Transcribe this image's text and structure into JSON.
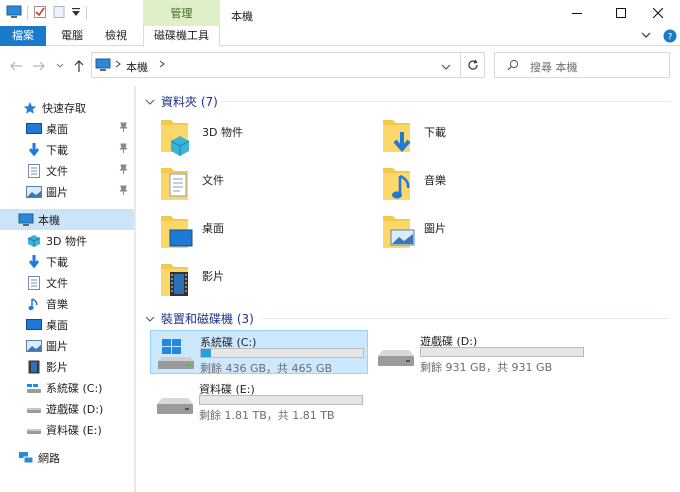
{
  "window": {
    "title": "本機",
    "context_tab": "管理"
  },
  "ribbon": {
    "tabs": [
      "檔案",
      "電腦",
      "檢視",
      "磁碟機工具"
    ]
  },
  "address": {
    "crumb": "本機"
  },
  "search": {
    "placeholder": "搜尋 本機"
  },
  "sidebar": {
    "quick_access": "快速存取",
    "quick_items": [
      "桌面",
      "下載",
      "文件",
      "圖片"
    ],
    "this_pc": "本機",
    "pc_items": [
      "3D 物件",
      "下載",
      "文件",
      "音樂",
      "桌面",
      "圖片",
      "影片",
      "系統碟 (C:)",
      "遊戲碟 (D:)",
      "資料碟 (E:)"
    ],
    "network": "網路"
  },
  "folders_group": {
    "title": "資料夾 (7)",
    "items": [
      "3D 物件",
      "下載",
      "文件",
      "音樂",
      "桌面",
      "圖片",
      "影片"
    ]
  },
  "drives_group": {
    "title": "裝置和磁碟機 (3)",
    "items": [
      {
        "name": "系統碟 (C:)",
        "free": "剩餘 436 GB，共 465 GB",
        "used_fraction": 0.06
      },
      {
        "name": "遊戲碟 (D:)",
        "free": "剩餘 931 GB，共 931 GB",
        "used_fraction": 0.0
      },
      {
        "name": "資料碟 (E:)",
        "free": "剩餘 1.81 TB，共 1.81 TB",
        "used_fraction": 0.0
      }
    ]
  },
  "colors": {
    "accent": "#1979ca",
    "selection": "#cce8ff",
    "bar_fill": "#26a0da",
    "context_tab": "#dff0c8"
  }
}
